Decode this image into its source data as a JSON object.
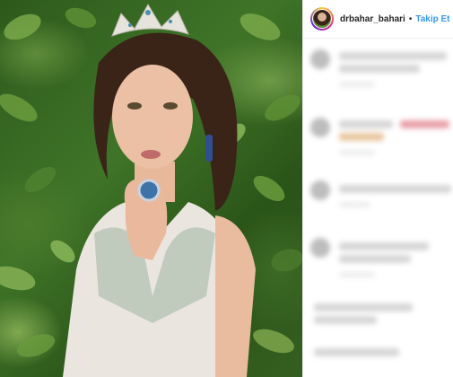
{
  "post": {
    "image_alt": "Woman wearing a jeweled crown and an embellished gown in front of green foliage"
  },
  "header": {
    "username": "drbahar_bahari",
    "separator": "•",
    "follow_label": "Takip Et"
  },
  "comments": {
    "blurred": true,
    "count_visible": 6
  },
  "colors": {
    "follow_blue": "#3897f0",
    "username_text": "#262626",
    "divider": "#efefef",
    "comment_accent": "#e8a0a8"
  },
  "icons": {
    "avatar": "profile-avatar-story-ring"
  }
}
